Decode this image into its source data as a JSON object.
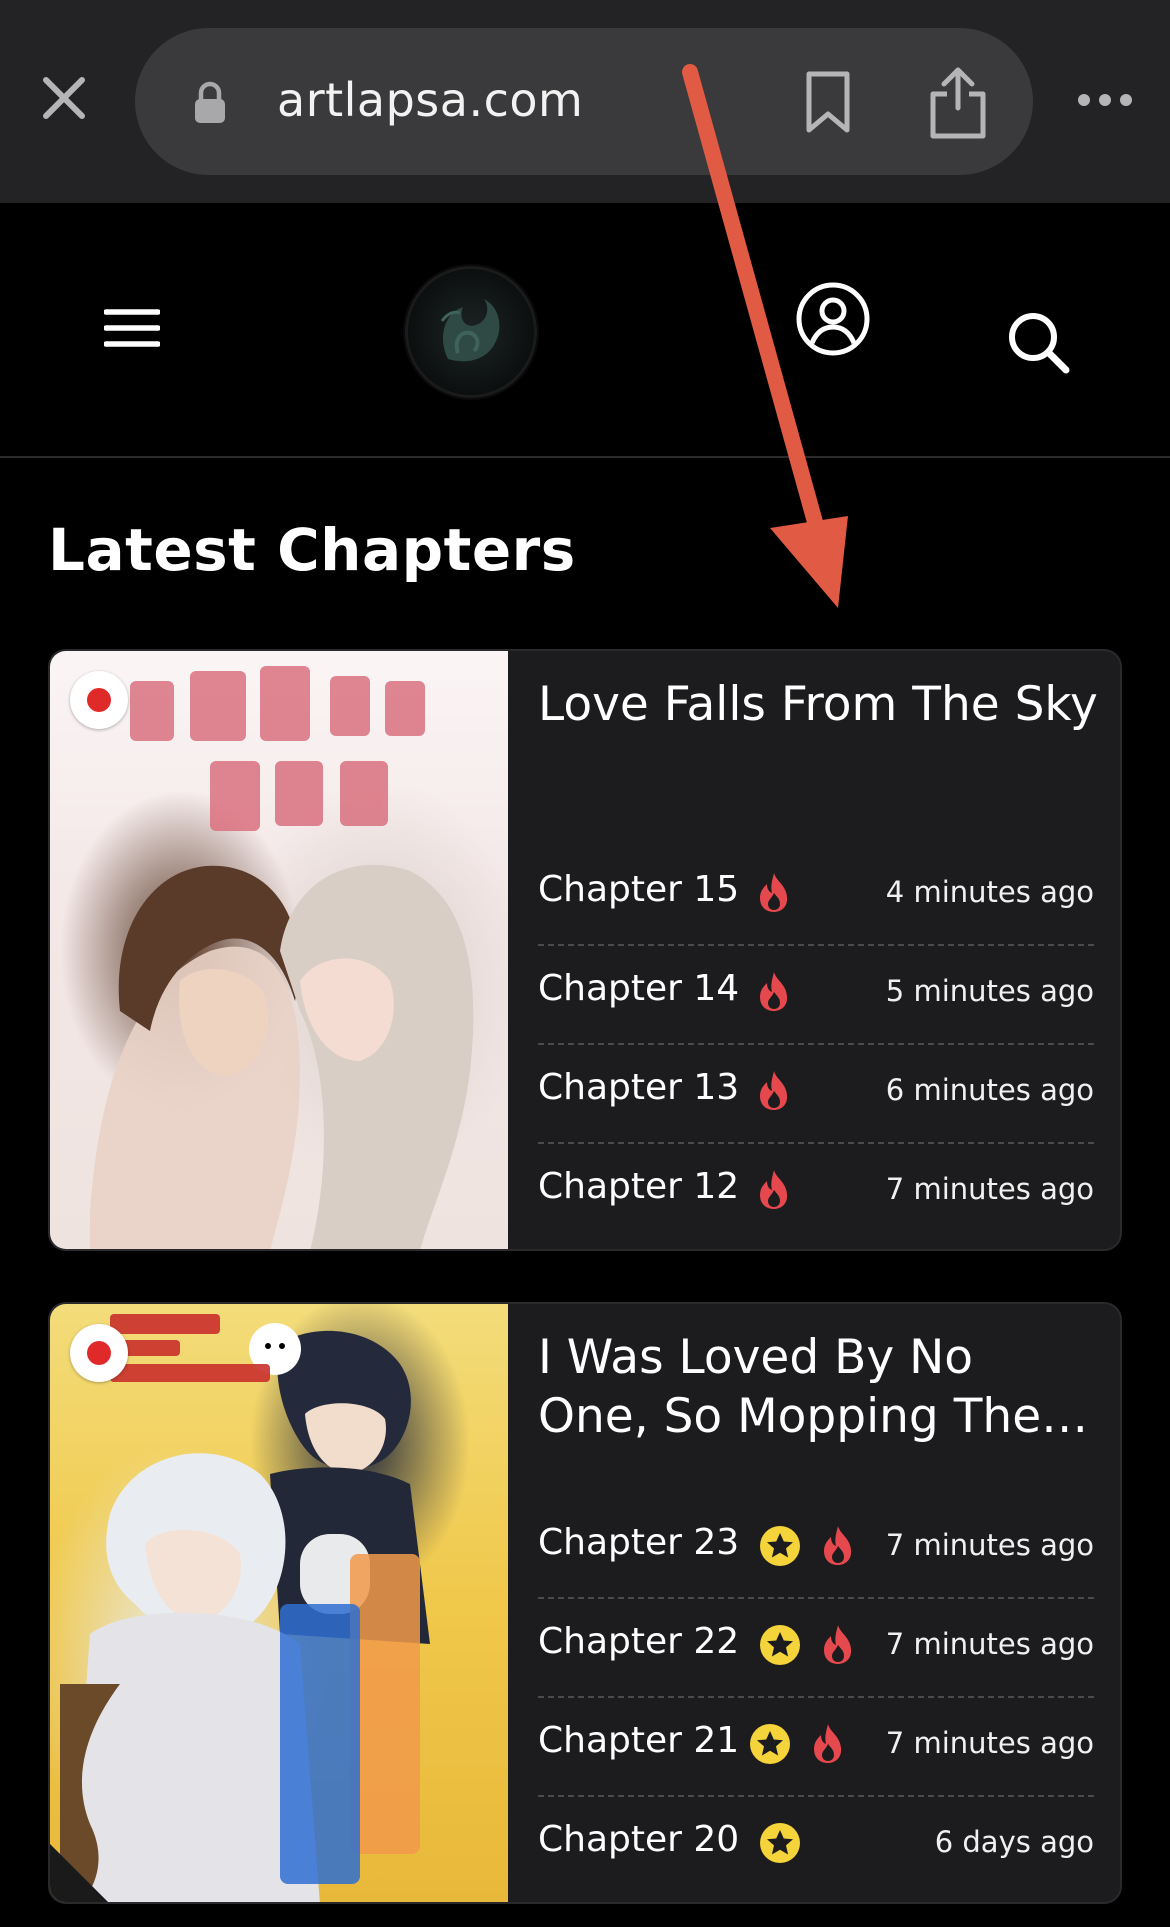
{
  "browser": {
    "url": "artlapsa.com"
  },
  "page": {
    "section_title": "Latest Chapters"
  },
  "colors": {
    "accent_fire": "#e5484d",
    "star": "#f5d33a",
    "annotation_arrow": "#e05a44",
    "card_bg": "#1c1c1e"
  },
  "cards": [
    {
      "title": "Love Falls From The Sky",
      "flag": "japan-flag",
      "chapters": [
        {
          "label": "Chapter 15",
          "time": "4 minutes ago",
          "icons": [
            "fire-icon"
          ]
        },
        {
          "label": "Chapter 14",
          "time": "5 minutes ago",
          "icons": [
            "fire-icon"
          ]
        },
        {
          "label": "Chapter 13",
          "time": "6 minutes ago",
          "icons": [
            "fire-icon"
          ]
        },
        {
          "label": "Chapter 12",
          "time": "7 minutes ago",
          "icons": [
            "fire-icon"
          ]
        }
      ]
    },
    {
      "title": "I Was Loved By No One, So Mopping The Floor...",
      "flag": "japan-flag",
      "chapters": [
        {
          "label": "Chapter 23",
          "time": "7 minutes ago",
          "icons": [
            "star-icon",
            "fire-icon"
          ]
        },
        {
          "label": "Chapter 22",
          "time": "7 minutes ago",
          "icons": [
            "star-icon",
            "fire-icon"
          ]
        },
        {
          "label": "Chapter 21",
          "time": "7 minutes ago",
          "icons": [
            "star-icon",
            "fire-icon"
          ]
        },
        {
          "label": "Chapter 20",
          "time": "6 days ago",
          "icons": [
            "star-icon"
          ]
        }
      ]
    }
  ]
}
